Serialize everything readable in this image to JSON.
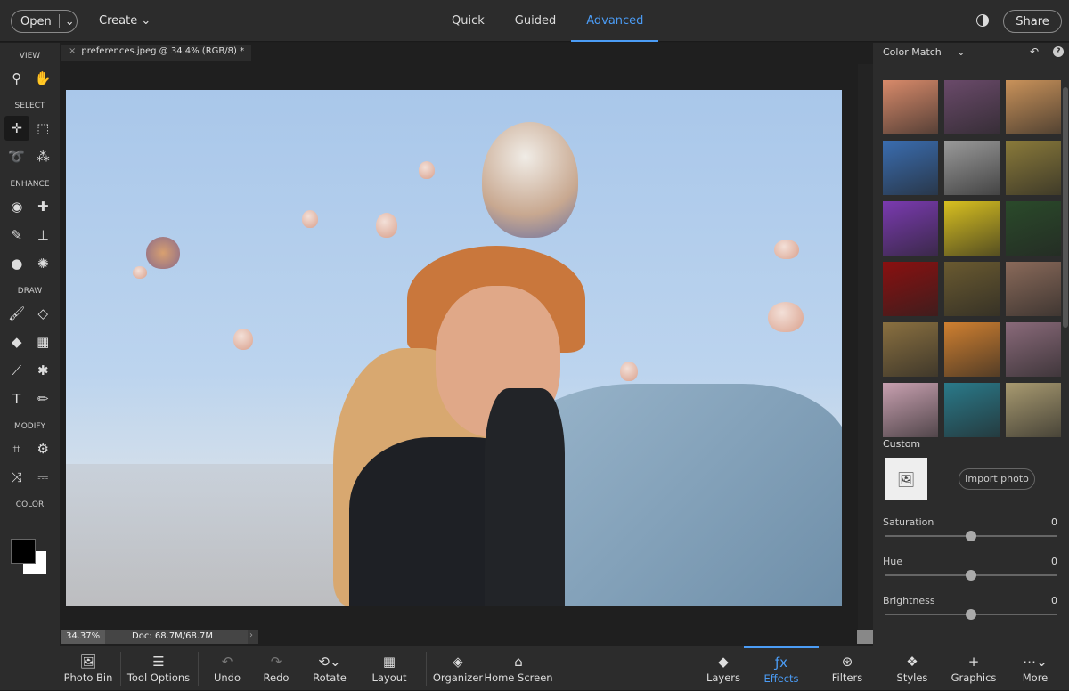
{
  "topbar": {
    "open": "Open",
    "create": "Create",
    "modes": [
      "Quick",
      "Guided",
      "Advanced"
    ],
    "active_mode": "Advanced",
    "share": "Share"
  },
  "tools": {
    "sections": {
      "view": "VIEW",
      "select": "SELECT",
      "enhance": "ENHANCE",
      "draw": "DRAW",
      "modify": "MODIFY",
      "color": "COLOR"
    }
  },
  "document": {
    "tab": "preferences.jpeg @ 34.4% (RGB/8) *",
    "zoom": "34.37%",
    "doc_size": "Doc: 68.7M/68.7M"
  },
  "panel": {
    "title": "Color Match",
    "custom": "Custom",
    "import": "Import photo",
    "sliders": [
      {
        "label": "Saturation",
        "value": "0",
        "level": 0.5
      },
      {
        "label": "Hue",
        "value": "0",
        "level": 0.5
      },
      {
        "label": "Brightness",
        "value": "0",
        "level": 0.5
      }
    ],
    "thumbnails": [
      "#d88a6a",
      "#6a4a6a",
      "#c9925a",
      "#3a6db0",
      "#9a9a9a",
      "#8a7a3a",
      "#7a3ab0",
      "#d8c020",
      "#2a4a2a",
      "#8a1010",
      "#6a5a30",
      "#8a6a5a",
      "#8a7040",
      "#d08030",
      "#8a6a7a",
      "#c8a0b0",
      "#2a7a8a",
      "#a89a70"
    ]
  },
  "bottombar": {
    "left": [
      {
        "label": "Photo Bin",
        "icon": "photo-bin-icon"
      },
      {
        "label": "Tool Options",
        "icon": "tool-options-icon"
      },
      {
        "label": "Undo",
        "icon": "undo-icon"
      },
      {
        "label": "Redo",
        "icon": "redo-icon"
      },
      {
        "label": "Rotate",
        "icon": "rotate-icon"
      },
      {
        "label": "Layout",
        "icon": "layout-icon"
      },
      {
        "label": "Organizer",
        "icon": "organizer-icon"
      },
      {
        "label": "Home Screen",
        "icon": "home-icon"
      }
    ],
    "right": [
      {
        "label": "Layers",
        "icon": "layers-icon"
      },
      {
        "label": "Effects",
        "icon": "fx-icon"
      },
      {
        "label": "Filters",
        "icon": "filters-icon"
      },
      {
        "label": "Styles",
        "icon": "styles-icon"
      },
      {
        "label": "Graphics",
        "icon": "plus-icon"
      },
      {
        "label": "More",
        "icon": "more-icon"
      }
    ],
    "active": "Effects"
  },
  "colors": {
    "accent": "#4b9cf5",
    "foreground": "#000000",
    "background": "#ffffff"
  }
}
